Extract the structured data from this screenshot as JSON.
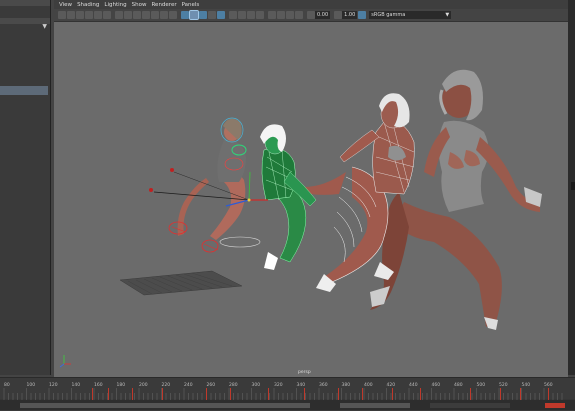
{
  "menubar": {
    "items": [
      "View",
      "Shading",
      "Lighting",
      "Show",
      "Renderer",
      "Panels"
    ]
  },
  "toolbar": {
    "exposure_value": "0.00",
    "gamma_value": "1.00",
    "color_space": "sRGB gamma"
  },
  "viewport": {
    "camera_label": "persp"
  },
  "timeline": {
    "ticks": [
      "80",
      "100",
      "120",
      "140",
      "160",
      "180",
      "200",
      "220",
      "240",
      "260",
      "280",
      "300",
      "320",
      "340",
      "360",
      "380",
      "400",
      "420",
      "440",
      "460",
      "480",
      "500",
      "520",
      "540",
      "560"
    ]
  },
  "colors": {
    "viewport_bg": "#6b6b6b",
    "key_mark": "#c0392b",
    "selection_green": "#3ddc6b"
  },
  "icons": [
    "camera-icon",
    "grid-icon",
    "wireframe-icon",
    "smooth-shade-icon",
    "texture-icon",
    "light-icon",
    "shadow-icon",
    "isolate-icon",
    "xray-icon",
    "exposure-icon",
    "gamma-icon"
  ]
}
